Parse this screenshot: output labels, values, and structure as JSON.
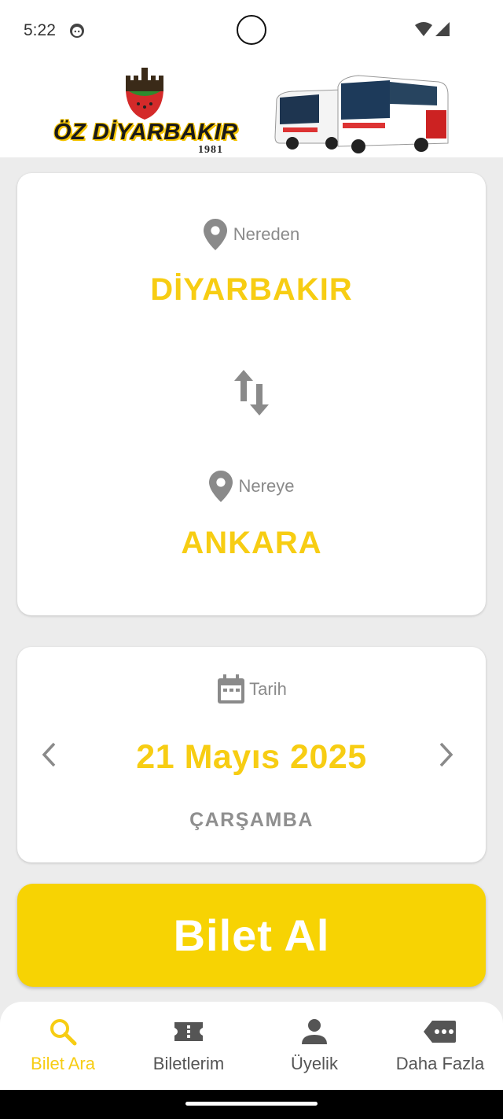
{
  "status_bar": {
    "time": "5:22"
  },
  "header": {
    "brand": "ÖZ DİYARBAKIR",
    "year": "1981"
  },
  "route": {
    "from_caption": "Nereden",
    "from_city": "DİYARBAKIR",
    "to_caption": "Nereye",
    "to_city": "ANKARA"
  },
  "date": {
    "caption": "Tarih",
    "value": "21 Mayıs 2025",
    "weekday": "ÇARŞAMBA"
  },
  "buy_button": {
    "label": "Bilet Al"
  },
  "bottom_nav": {
    "items": [
      {
        "label": "Bilet Ara",
        "icon": "search-icon",
        "active": true
      },
      {
        "label": "Biletlerim",
        "icon": "ticket-icon",
        "active": false
      },
      {
        "label": "Üyelik",
        "icon": "person-icon",
        "active": false
      },
      {
        "label": "Daha Fazla",
        "icon": "more-icon",
        "active": false
      }
    ]
  },
  "colors": {
    "accent": "#f7cd13",
    "button": "#f7d303",
    "muted": "#8a8a8a",
    "background": "#ececec"
  }
}
